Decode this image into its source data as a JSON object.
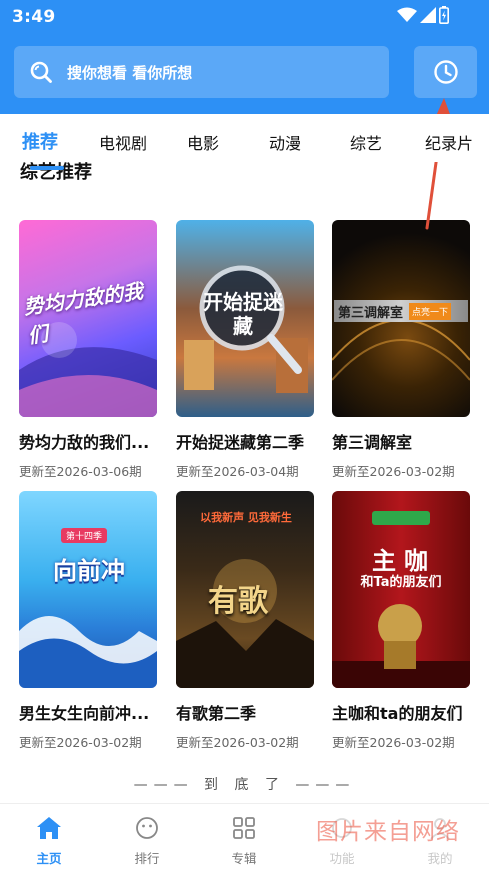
{
  "status_bar": {
    "time": "3:49"
  },
  "search": {
    "placeholder": "搜你想看 看你所想"
  },
  "tabs": [
    {
      "label": "推荐",
      "active": true
    },
    {
      "label": "电视剧"
    },
    {
      "label": "电影"
    },
    {
      "label": "动漫"
    },
    {
      "label": "综艺"
    },
    {
      "label": "纪录片"
    }
  ],
  "section": {
    "title": "综艺推荐"
  },
  "cards": [
    {
      "title": "势均力敌的我们...",
      "subtitle": "更新至2026-03-06期",
      "poster_text": "势均力敌的我们"
    },
    {
      "title": "开始捉迷藏第二季",
      "subtitle": "更新至2026-03-04期",
      "poster_text": "开始捉迷藏"
    },
    {
      "title": "第三调解室",
      "subtitle": "更新至2026-03-02期",
      "poster_text": "第三调解室",
      "poster_badge": "点亮一下"
    },
    {
      "title": "男生女生向前冲...",
      "subtitle": "更新至2026-03-02期",
      "poster_text": "向前冲",
      "poster_badge": "第十四季"
    },
    {
      "title": "有歌第二季",
      "subtitle": "更新至2026-03-02期",
      "poster_text": "有歌",
      "poster_badge": "以我新声 见我新生"
    },
    {
      "title": "主咖和ta的朋友们",
      "subtitle": "更新至2026-03-02期",
      "poster_text": "主咖",
      "poster_badge": "和Ta的朋友们"
    }
  ],
  "end_text": "——— 到 底 了 ———",
  "bottom_nav": [
    {
      "label": "主页",
      "icon": "home-icon",
      "active": true
    },
    {
      "label": "排行",
      "icon": "smile-icon"
    },
    {
      "label": "专辑",
      "icon": "grid-icon"
    },
    {
      "label": "功能",
      "icon": "function-icon"
    },
    {
      "label": "我的",
      "icon": "user-icon"
    }
  ],
  "watermark": "图片来自网络",
  "colors": {
    "accent": "#2d90f5",
    "annotation_arrow": "#e0503a"
  }
}
